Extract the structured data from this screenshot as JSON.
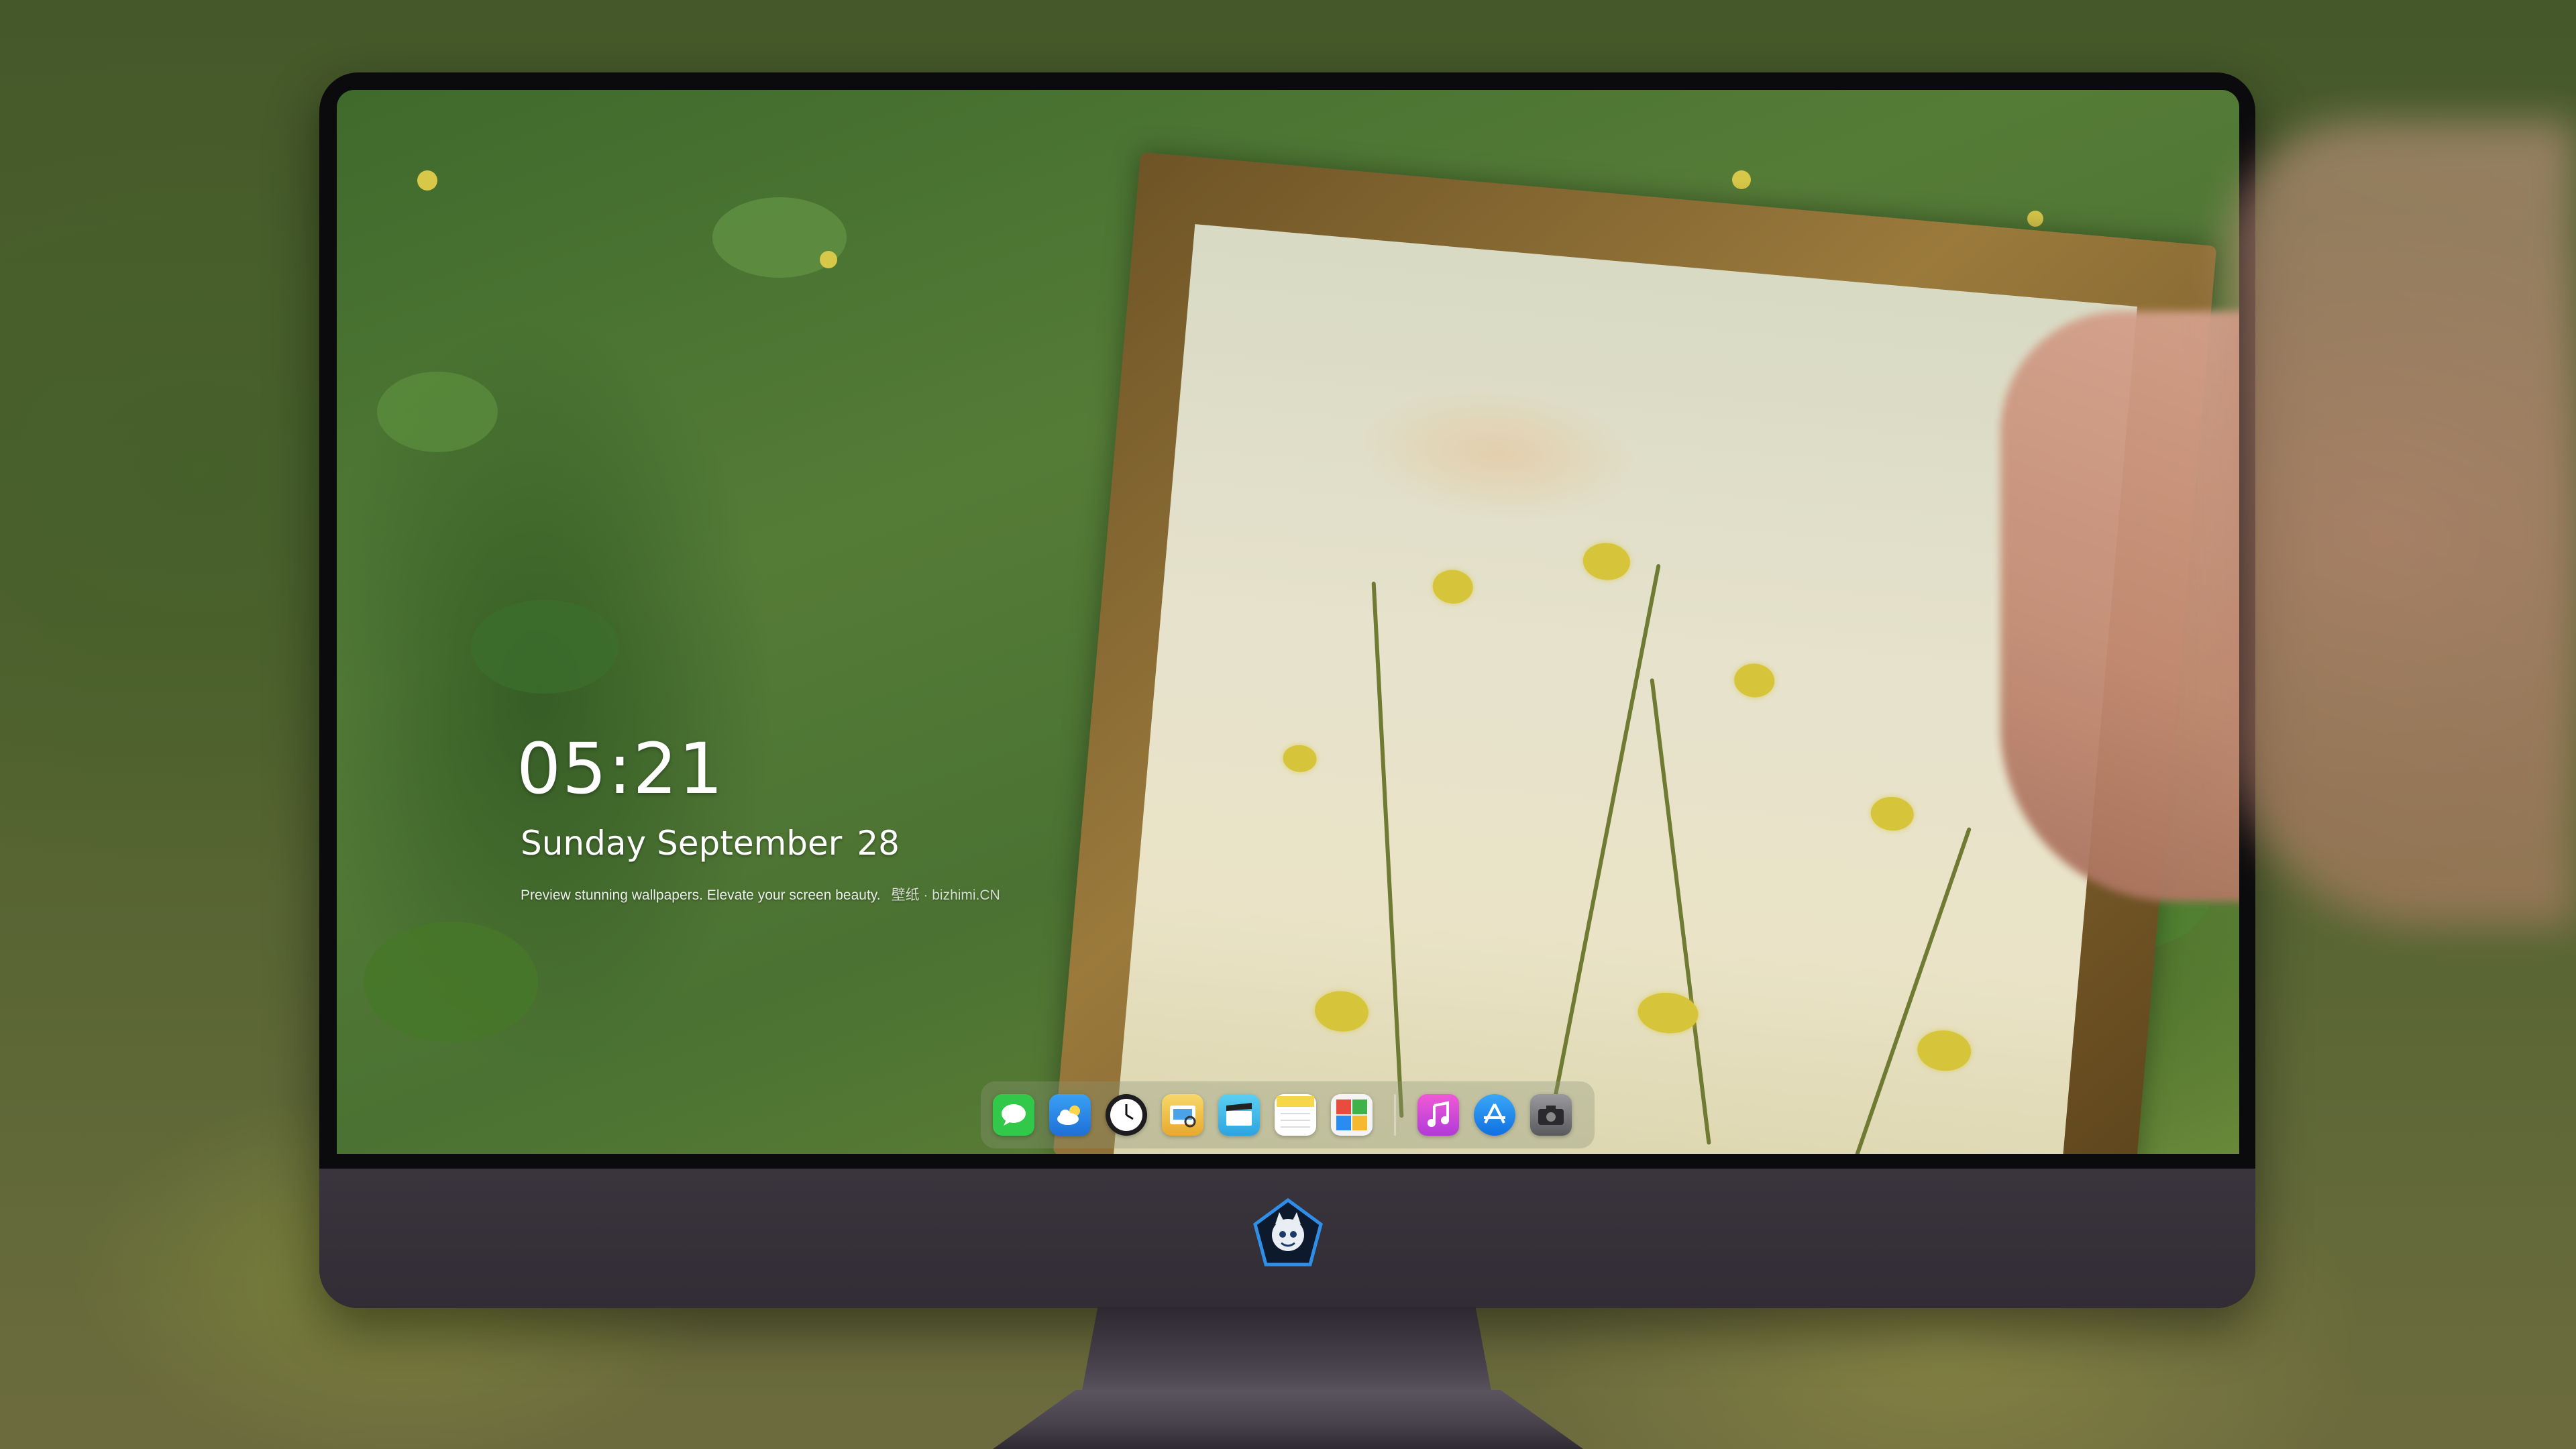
{
  "lockscreen": {
    "time": "05:21",
    "weekday_month": "Sunday September",
    "day": "28",
    "tagline": "Preview stunning wallpapers. Elevate your screen beauty.",
    "tagline_site": "壁纸 · bizhimi.CN"
  },
  "dock": {
    "apps": [
      {
        "name": "Messages",
        "icon": "message-bubble-icon",
        "color": "#32c94a"
      },
      {
        "name": "Weather",
        "icon": "weather-cloud-icon",
        "color": "#2a8cf0"
      },
      {
        "name": "Clock",
        "icon": "clock-icon",
        "color": "#f5f5f5"
      },
      {
        "name": "Preview",
        "icon": "preview-icon",
        "color": "#f2c23a"
      },
      {
        "name": "Clips",
        "icon": "clapperboard-icon",
        "color": "#42b6e8"
      },
      {
        "name": "Notes",
        "icon": "notes-icon",
        "color": "#f7d64a"
      },
      {
        "name": "Photo Booth",
        "icon": "photos-grid-icon",
        "color": "#e94b3c"
      },
      {
        "name": "Music",
        "icon": "music-note-icon",
        "color": "#e04ad0"
      },
      {
        "name": "App Store",
        "icon": "app-store-icon",
        "color": "#1c8ef0"
      },
      {
        "name": "Camera",
        "icon": "camera-icon",
        "color": "#5a5a5e"
      }
    ]
  }
}
